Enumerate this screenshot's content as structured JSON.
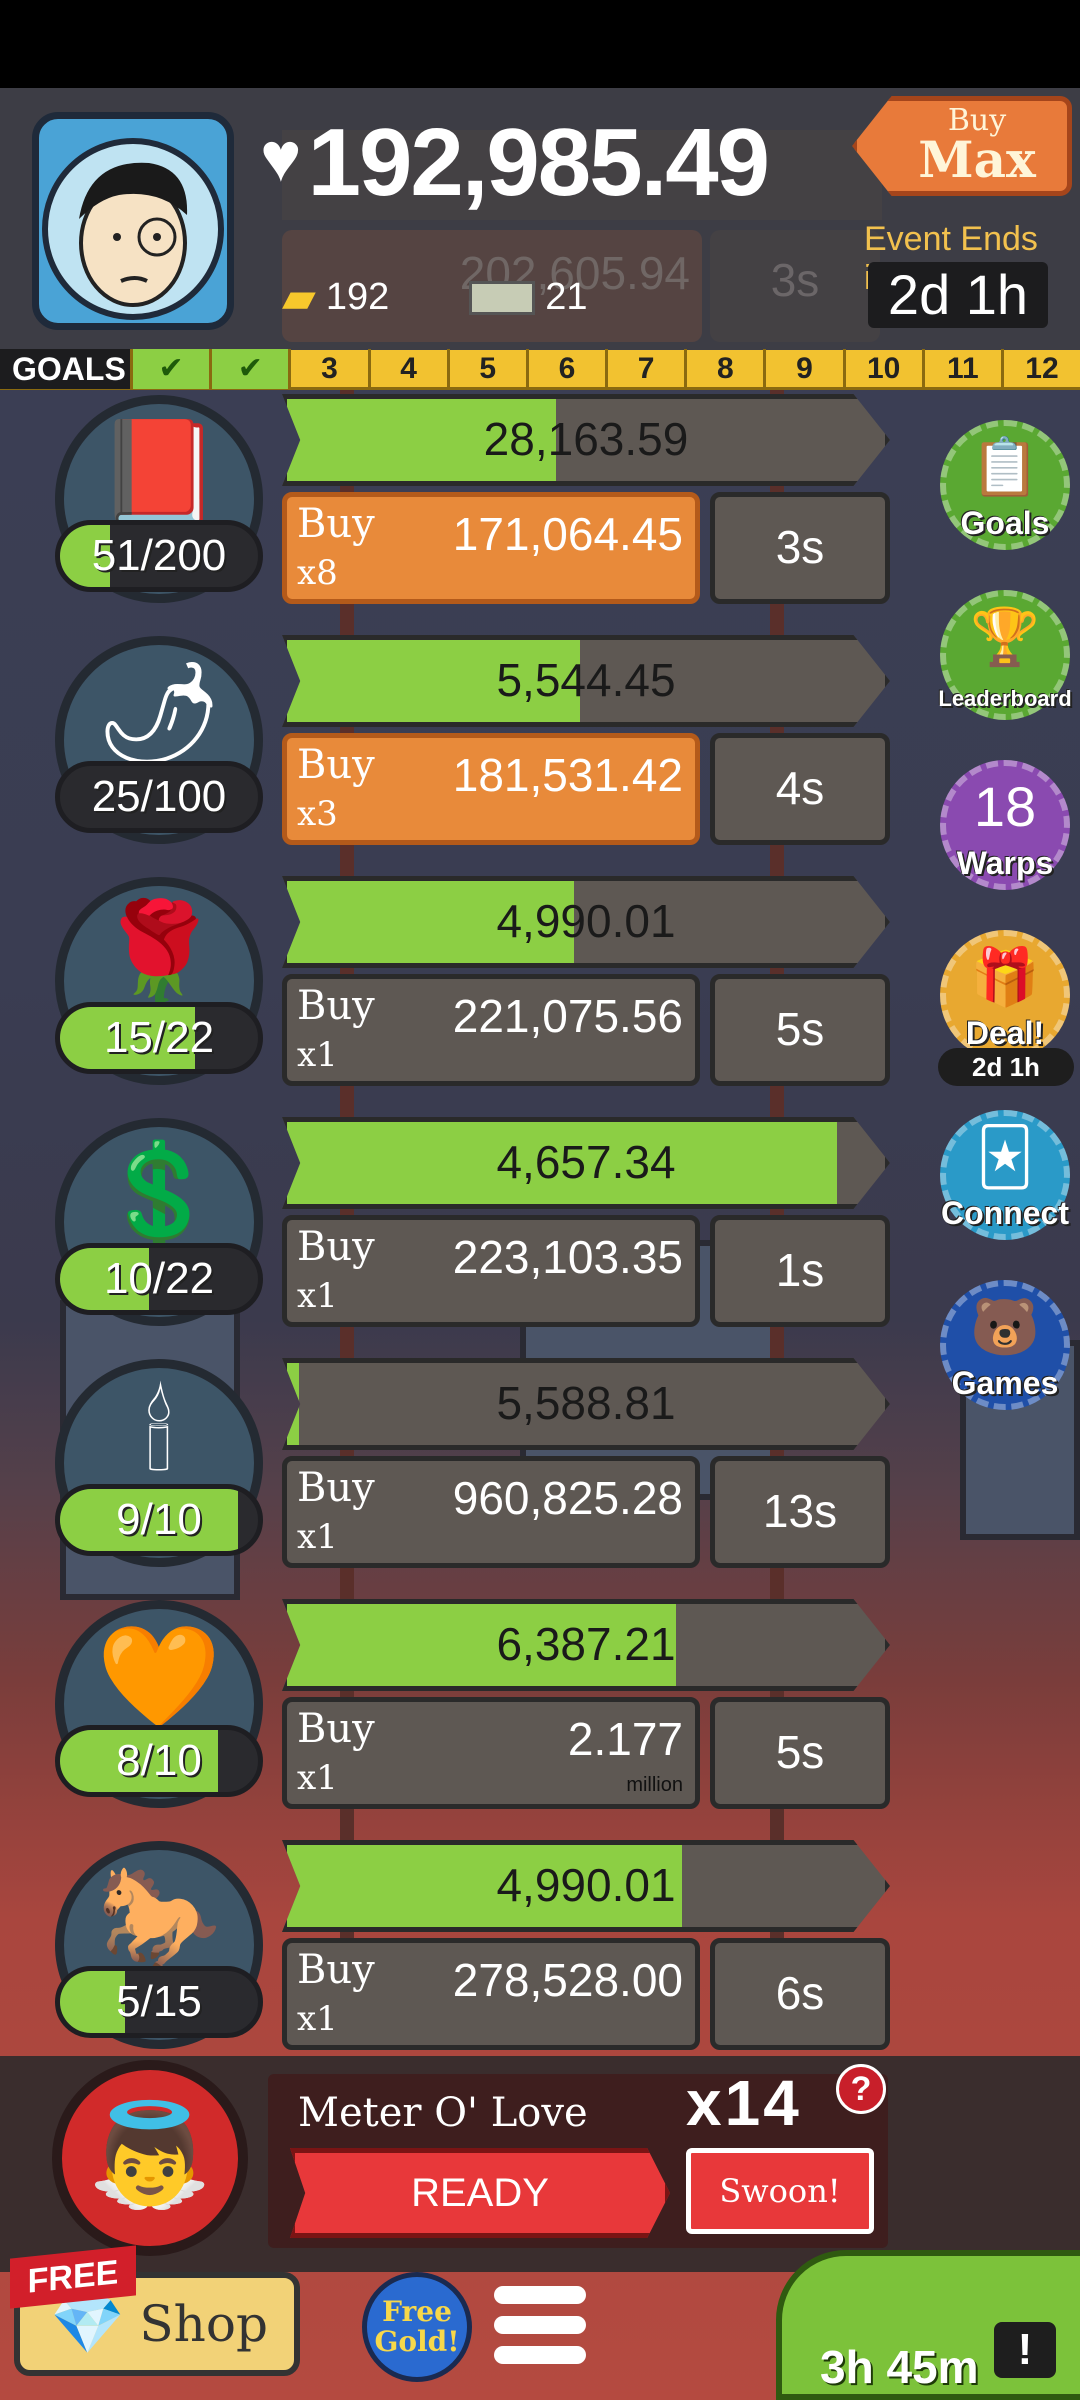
{
  "header": {
    "money": "192,985.49",
    "gold_count": "192",
    "cash_count": "21",
    "buy_max": {
      "top": "Buy",
      "bottom": "Max"
    },
    "event_label": "Event Ends in:",
    "event_timer": "2d 1h",
    "ghost_cost": "202,605.94",
    "ghost_timer": "3s"
  },
  "goals": {
    "label": "GOALS",
    "cells": [
      "",
      "",
      "3",
      "4",
      "5",
      "6",
      "7",
      "8",
      "9",
      "10",
      "11",
      "12"
    ],
    "completed": 2
  },
  "rows": [
    {
      "icon": "book-icon",
      "glyph": "📕",
      "count": "51/200",
      "count_fraction": 0.255,
      "progress_value": "28,163.59",
      "progress": 0.45,
      "buy": "Buy",
      "mult": "x8",
      "cost": "171,064.45",
      "unit": "",
      "orange": true,
      "timer": "3s"
    },
    {
      "icon": "hot-sauce-icon",
      "glyph": "🌶",
      "count": "25/100",
      "count_fraction": 0.0,
      "progress_value": "5,544.45",
      "progress": 0.49,
      "buy": "Buy",
      "mult": "x3",
      "cost": "181,531.42",
      "unit": "",
      "orange": true,
      "timer": "4s"
    },
    {
      "icon": "roses-vase-icon",
      "glyph": "🌹",
      "count": "15/22",
      "count_fraction": 0.68,
      "progress_value": "4,990.01",
      "progress": 0.48,
      "buy": "Buy",
      "mult": "x1",
      "cost": "221,075.56",
      "unit": "",
      "orange": false,
      "timer": "5s"
    },
    {
      "icon": "necklace-icon",
      "glyph": "💲",
      "count": "10/22",
      "count_fraction": 0.45,
      "progress_value": "4,657.34",
      "progress": 0.92,
      "buy": "Buy",
      "mult": "x1",
      "cost": "223,103.35",
      "unit": "",
      "orange": false,
      "timer": "1s"
    },
    {
      "icon": "candle-dinner-icon",
      "glyph": "🕯",
      "count": "9/10",
      "count_fraction": 0.9,
      "progress_value": "5,588.81",
      "progress": 0.02,
      "buy": "Buy",
      "mult": "x1",
      "cost": "960,825.28",
      "unit": "",
      "orange": false,
      "timer": "13s"
    },
    {
      "icon": "heart-candy-icon",
      "glyph": "🧡",
      "count": "8/10",
      "count_fraction": 0.8,
      "progress_value": "6,387.21",
      "progress": 0.65,
      "buy": "Buy",
      "mult": "x1",
      "cost": "2.177",
      "unit": "million",
      "orange": false,
      "timer": "5s"
    },
    {
      "icon": "carriage-icon",
      "glyph": "🐎",
      "count": "5/15",
      "count_fraction": 0.33,
      "progress_value": "4,990.01",
      "progress": 0.66,
      "buy": "Buy",
      "mult": "x1",
      "cost": "278,528.00",
      "unit": "",
      "orange": false,
      "timer": "6s"
    }
  ],
  "side": [
    {
      "name": "goals-badge",
      "icon": "checklist-icon",
      "glyph": "📋",
      "label": "Goals",
      "color": "#5aa832"
    },
    {
      "name": "leaderboard-badge",
      "icon": "trophy-icon",
      "glyph": "🏆",
      "label": "Leaderboard",
      "color": "#5aa832"
    },
    {
      "name": "warps-badge",
      "icon": "clock-icon",
      "glyph": "18",
      "label": "Warps",
      "color": "#8a4ab0"
    },
    {
      "name": "deal-badge",
      "icon": "gift-icon",
      "glyph": "🎁",
      "label": "Deal!",
      "sub": "2d 1h",
      "color": "#e8a830"
    },
    {
      "name": "connect-badge",
      "icon": "cards-icon",
      "glyph": "🃏",
      "label": "Connect",
      "color": "#2a9ac8"
    },
    {
      "name": "games-badge",
      "icon": "games-icon",
      "glyph": "🐻",
      "label": "Games",
      "color": "#1f4fa8"
    }
  ],
  "meter": {
    "title": "Meter O' Love",
    "multiplier": "x14",
    "help": "?",
    "ready": "READY",
    "swoon": "Swoon!"
  },
  "bottom": {
    "free_flag": "FREE",
    "shop": "Shop",
    "free_gold": "Free Gold!",
    "timer": "3h 45m",
    "tv": "!"
  }
}
